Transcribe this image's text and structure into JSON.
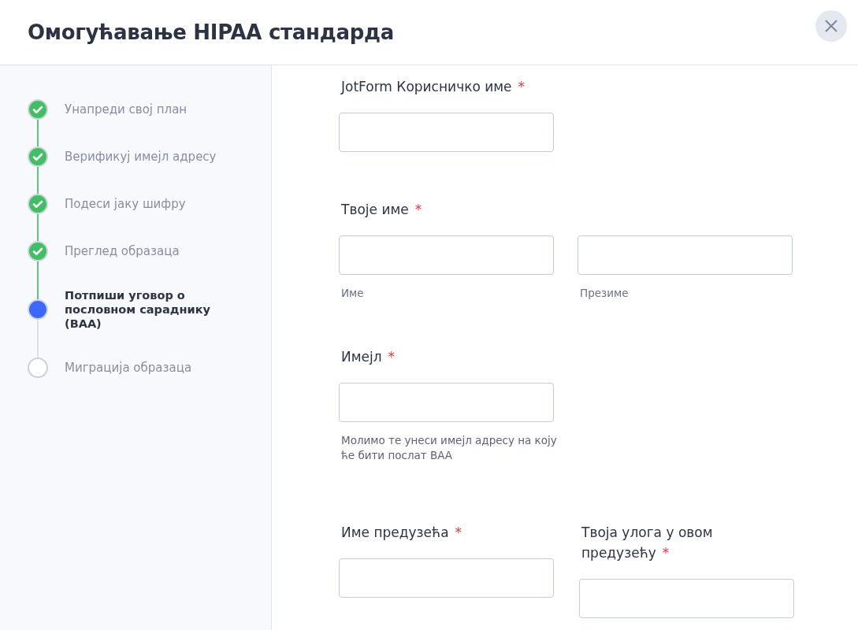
{
  "dialog": {
    "title": "Омогућавање HIPAA стандарда"
  },
  "steps": [
    {
      "label": "Унапреди свој план",
      "completed": true,
      "selected": false
    },
    {
      "label": "Верификуј имејл адресу",
      "completed": true,
      "selected": false
    },
    {
      "label": "Подеси јаку шифру",
      "completed": true,
      "selected": false
    },
    {
      "label": "Преглед образаца",
      "completed": true,
      "selected": false
    },
    {
      "label": "Потпиши уговор о пословном сараднику (BAA)",
      "completed": false,
      "selected": true
    },
    {
      "label": "Миграција образаца",
      "completed": false,
      "selected": false
    }
  ],
  "form": {
    "rows": [
      {
        "columns": [
          {
            "label": "JotForm Корисничко име",
            "required_mark": "*"
          }
        ]
      },
      {
        "columns": [
          {
            "label": "Твоје име",
            "required_mark": "*",
            "inputs": [
              {
                "sublabel": "Име"
              },
              {
                "sublabel": "Презиме"
              }
            ]
          }
        ]
      },
      {
        "columns": [
          {
            "label": "Имејл",
            "required_mark": "*",
            "help": "Молимо те унеси имејл адресу на коју ће бити послат BAA"
          }
        ]
      },
      {
        "columns": [
          {
            "label": "Име предузећа",
            "required_mark": "*"
          },
          {
            "label": "Твоја улога у овом предузећу",
            "required_mark": "*"
          }
        ]
      }
    ]
  }
}
